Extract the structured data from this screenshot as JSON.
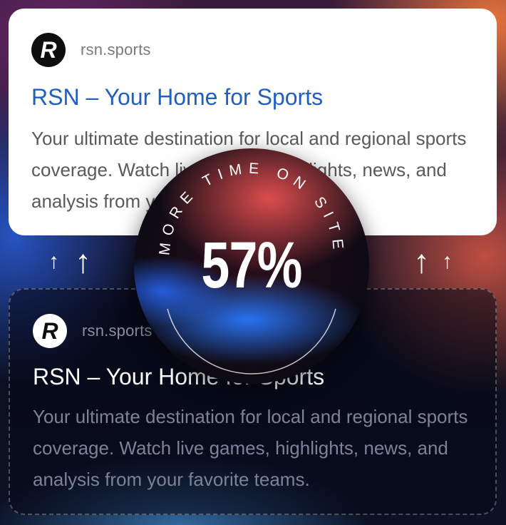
{
  "top_card": {
    "site": "rsn.sports",
    "title": "RSN – Your Home for Sports",
    "description": "Your ultimate destination for local and regional sports coverage. Watch live games, highlights, news, and analysis from your favorite teams."
  },
  "bottom_card": {
    "site": "rsn.sports",
    "title": "RSN – Your Home for Sports",
    "description": "Your ultimate destination for local and regional sports coverage. Watch live games, highlights, news, and analysis from your favorite teams."
  },
  "badge": {
    "arc_text": "MORE TIME ON SITE",
    "value": "57%"
  },
  "arrows": {
    "glyph": "↑"
  },
  "logo": {
    "letter": "R"
  },
  "colors": {
    "title_blue": "#1f5fc4",
    "card_bg": "#ffffff"
  }
}
